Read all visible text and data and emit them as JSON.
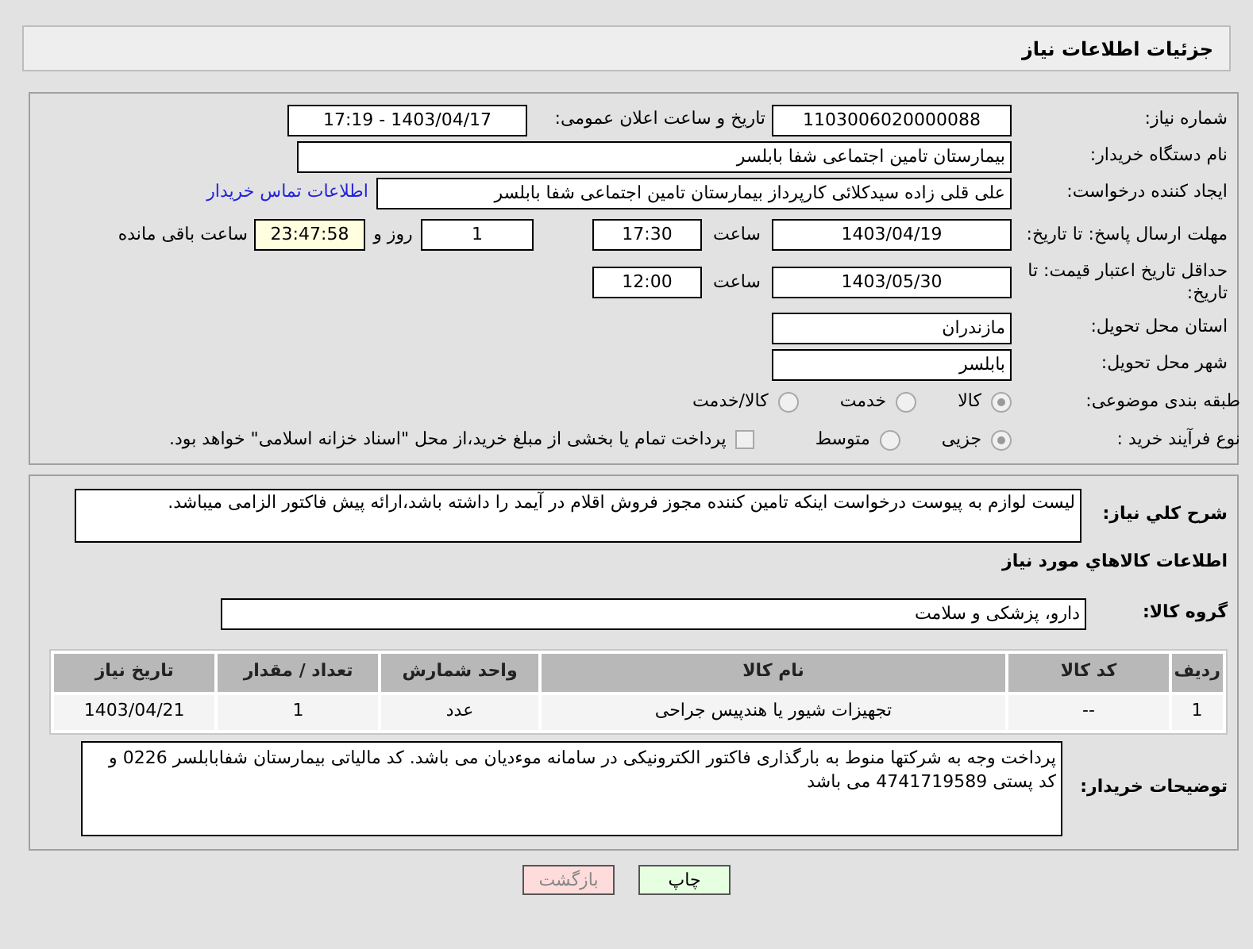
{
  "header": {
    "title": "جزئیات اطلاعات نیاز"
  },
  "need_number": {
    "label": "شماره نیاز:",
    "value": "1103006020000088"
  },
  "announce": {
    "label": "تاریخ و ساعت اعلان عمومی:",
    "value": "1403/04/17 - 17:19"
  },
  "buyer_org": {
    "label": "نام دستگاه خریدار:",
    "value": "بیمارستان تامین اجتماعی شفا بابلسر"
  },
  "requester": {
    "label": "ایجاد کننده درخواست:",
    "value": "علی قلی زاده سیدکلائی کارپرداز بیمارستان تامین اجتماعی شفا بابلسر",
    "link": "اطلاعات تماس خریدار"
  },
  "deadline": {
    "label": "مهلت ارسال پاسخ: تا تاریخ:",
    "date": "1403/04/19",
    "time_label": "ساعت",
    "time": "17:30",
    "days": "1",
    "days_label": "روز و",
    "remaining": "23:47:58",
    "remaining_label": "ساعت باقی مانده"
  },
  "validity": {
    "label": "حداقل تاریخ اعتبار قیمت: تا تاریخ:",
    "date": "1403/05/30",
    "time_label": "ساعت",
    "time": "12:00"
  },
  "province": {
    "label": "استان محل تحویل:",
    "value": "مازندران"
  },
  "city": {
    "label": "شهر محل تحویل:",
    "value": "بابلسر"
  },
  "category": {
    "label": "طبقه بندی موضوعی:",
    "options": [
      {
        "label": "کالا",
        "selected": true
      },
      {
        "label": "خدمت",
        "selected": false
      },
      {
        "label": "کالا/خدمت",
        "selected": false
      }
    ]
  },
  "process": {
    "label": "نوع فرآیند خرید :",
    "options": [
      {
        "label": "جزیی",
        "selected": true
      },
      {
        "label": "متوسط",
        "selected": false
      }
    ],
    "payment": {
      "checked": false,
      "text": "پرداخت تمام یا بخشی از مبلغ خرید،از محل \"اسناد خزانه اسلامی\" خواهد بود."
    }
  },
  "description": {
    "label": "شرح کلي نیاز:",
    "text": "لیست لوازم به پیوست درخواست اینکه  تامین کننده مجوز فروش اقلام در آیمد را داشته باشد،ارائه پیش فاکتور الزامی میباشد."
  },
  "goods_heading": "اطلاعات کالاهاي مورد نیاز",
  "goods_group": {
    "label": "گروه کالا:",
    "value": "دارو، پزشکی و سلامت"
  },
  "table": {
    "columns": [
      "ردیف",
      "کد کالا",
      "نام کالا",
      "واحد شمارش",
      "تعداد / مقدار",
      "تاریخ نیاز"
    ],
    "rows": [
      [
        "1",
        "--",
        "تجهیزات شیور یا هندپیس جراحی",
        "عدد",
        "1",
        "1403/04/21"
      ]
    ]
  },
  "buyer_notes": {
    "label": "توضیحات خریدار:",
    "lines": [
      "پرداخت وجه به شرکتها منوط به بارگذاری فاکتور الکترونیکی در سامانه موءدیان می باشد. کد مالیاتی بیمارستان شفابابلسر 0226 و",
      "کد پستی 4741719589 می باشد"
    ]
  },
  "buttons": [
    {
      "label": "چاپ",
      "kind": "print"
    },
    {
      "label": "بازگشت",
      "kind": "back"
    }
  ]
}
